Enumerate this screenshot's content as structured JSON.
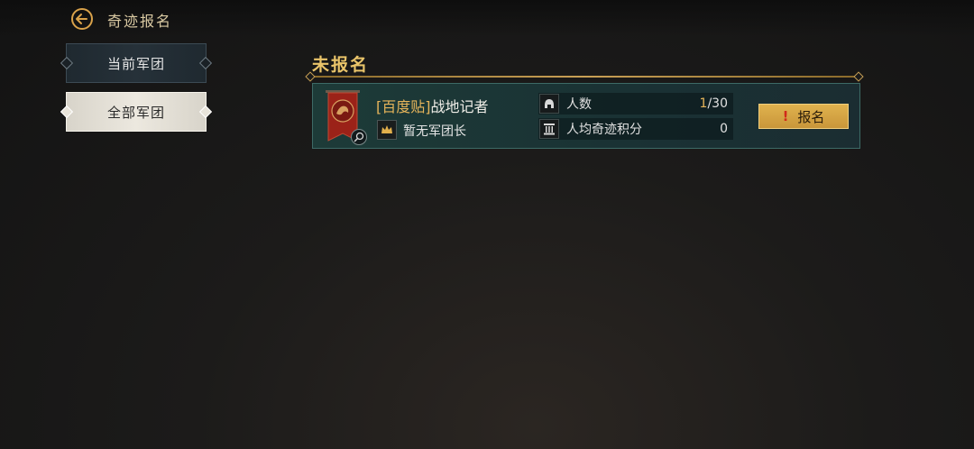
{
  "header": {
    "title": "奇迹报名",
    "back_icon": "back-arrow-icon"
  },
  "tabs": [
    {
      "label": "当前军团",
      "selected": false
    },
    {
      "label": "全部军团",
      "selected": true
    }
  ],
  "section": {
    "title": "未报名"
  },
  "legion": {
    "tag": "[百度贴]",
    "name": "战地记者",
    "leader_text": "暂无军团长",
    "stats": {
      "members_label": "人数",
      "members_current": "1",
      "members_max": "/30",
      "score_label": "人均奇迹积分",
      "score_value": "0"
    },
    "signup_button": {
      "warn": "!",
      "label": "报名"
    }
  },
  "colors": {
    "accent": "#e9c46a",
    "card": "#1d3b38",
    "button": "#d9a845",
    "banner": "#9b2218"
  }
}
